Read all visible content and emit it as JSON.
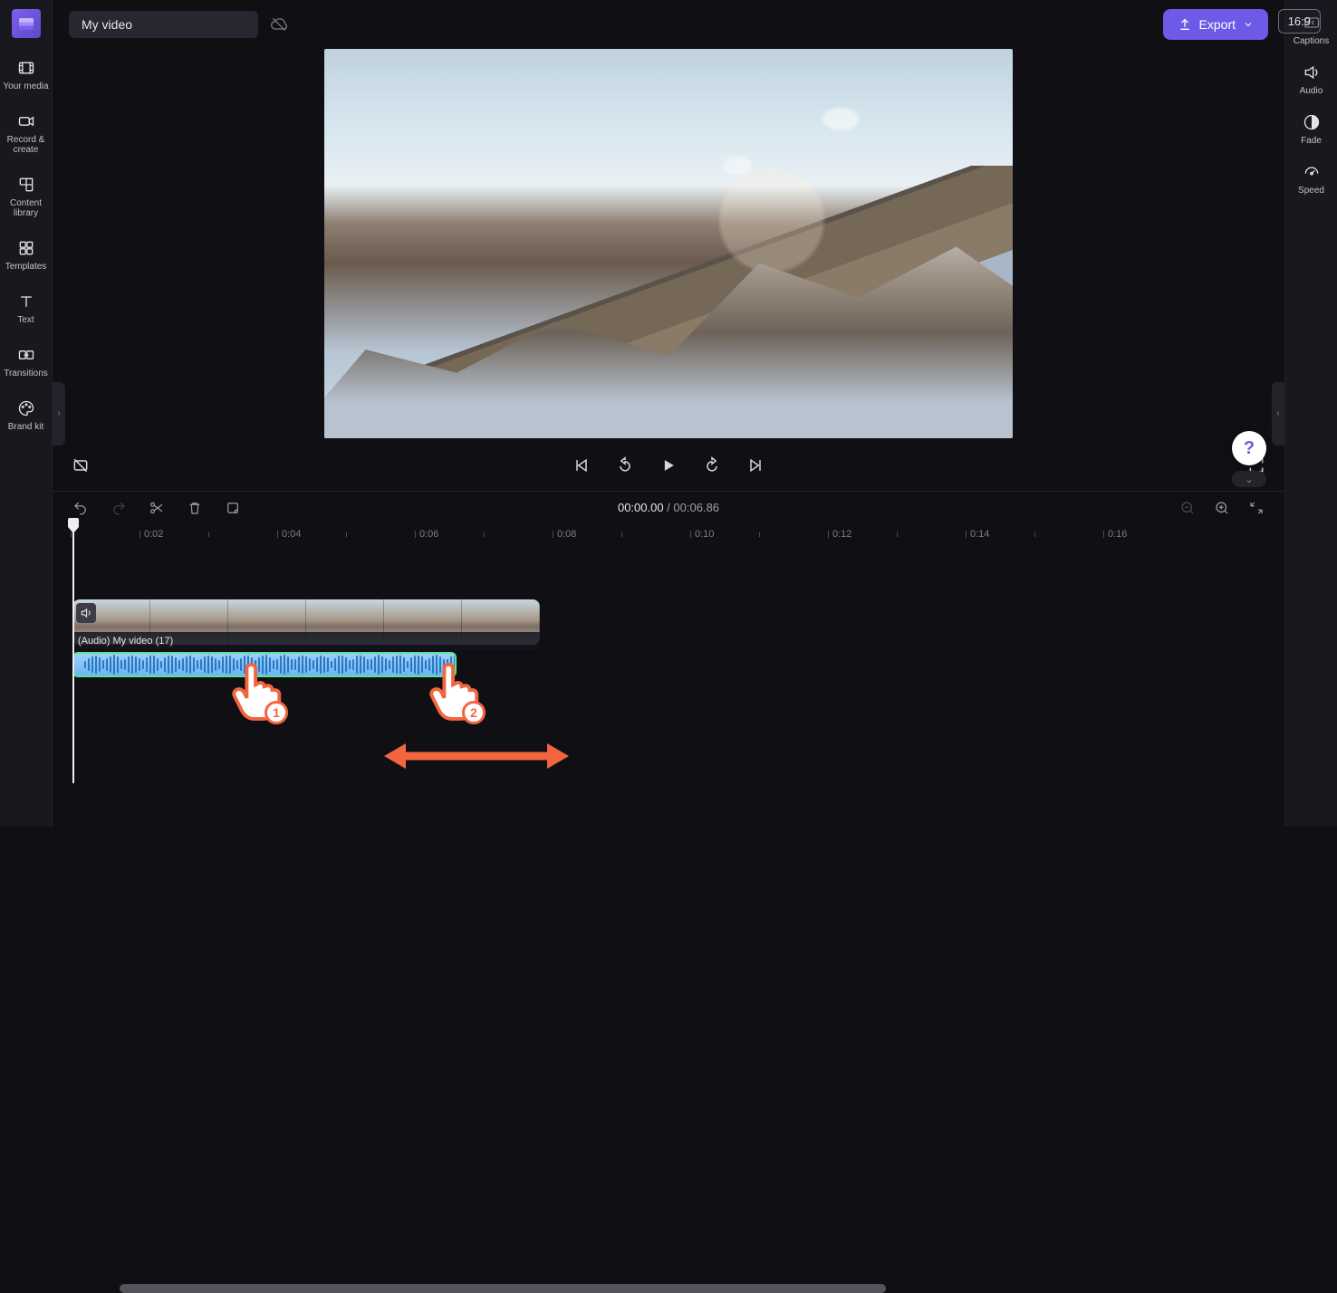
{
  "header": {
    "project_title": "My video",
    "export_label": "Export"
  },
  "sidebar_left": {
    "items": [
      {
        "label": "Your media",
        "icon": "film-icon"
      },
      {
        "label": "Record & create",
        "icon": "camera-icon"
      },
      {
        "label": "Content library",
        "icon": "library-icon"
      },
      {
        "label": "Templates",
        "icon": "grid-icon"
      },
      {
        "label": "Text",
        "icon": "text-t-icon"
      },
      {
        "label": "Transitions",
        "icon": "transition-icon"
      },
      {
        "label": "Brand kit",
        "icon": "palette-icon"
      }
    ]
  },
  "sidebar_right": {
    "items": [
      {
        "label": "Captions",
        "icon": "cc-icon"
      },
      {
        "label": "Audio",
        "icon": "speaker-icon"
      },
      {
        "label": "Fade",
        "icon": "fade-icon"
      },
      {
        "label": "Speed",
        "icon": "speedometer-icon"
      }
    ]
  },
  "preview": {
    "aspect": "16:9"
  },
  "playback": {
    "current": "00:00.00",
    "total": "00:06.86"
  },
  "ruler": {
    "marks": [
      "0:02",
      "0:04",
      "0:06",
      "0:08",
      "0:10",
      "0:12",
      "0:14",
      "0:16"
    ]
  },
  "tracks": {
    "audio_label": "(Audio) My video (17)"
  },
  "annotations": {
    "hand1": "1",
    "hand2": "2"
  }
}
